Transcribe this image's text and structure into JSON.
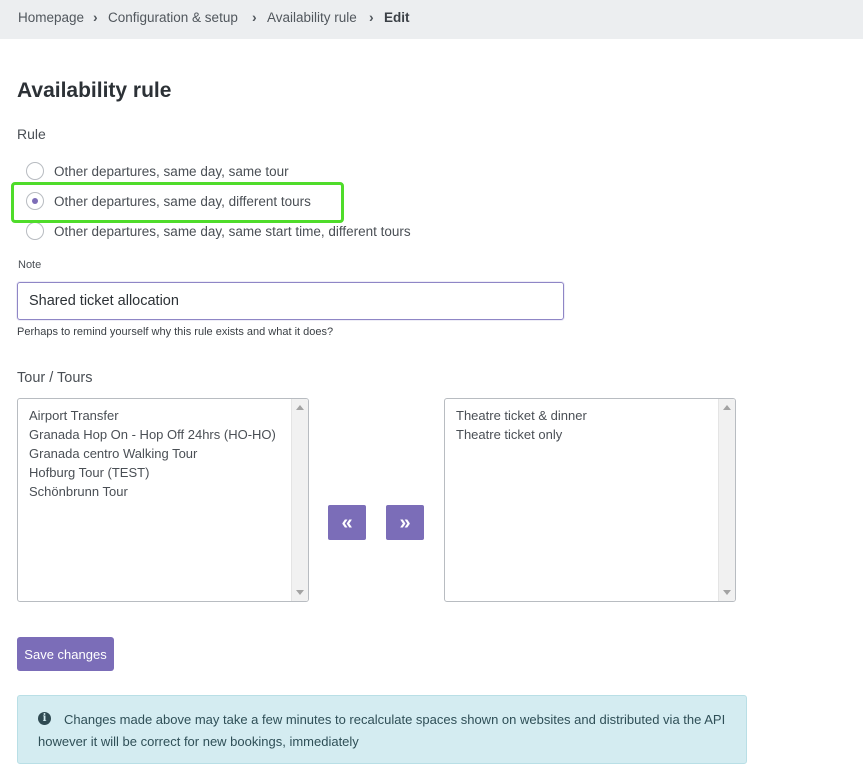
{
  "breadcrumb": {
    "items": [
      "Homepage",
      "Configuration & setup",
      "Availability rule"
    ],
    "current": "Edit",
    "separator": "›"
  },
  "page": {
    "title": "Availability rule"
  },
  "rule": {
    "label": "Rule",
    "options": [
      {
        "label": "Other departures, same day, same tour",
        "selected": false
      },
      {
        "label": "Other departures, same day, different tours",
        "selected": true
      },
      {
        "label": "Other departures, same day, same start time, different tours",
        "selected": false
      }
    ],
    "highlight_color": "#4fdc2a"
  },
  "note": {
    "label": "Note",
    "value": "Shared ticket allocation",
    "help": "Perhaps to remind yourself why this rule exists and what it does?"
  },
  "tours": {
    "label": "Tour / Tours",
    "available": [
      "Airport Transfer",
      "Granada Hop On - Hop Off 24hrs (HO-HO)",
      "Granada centro Walking Tour",
      "Hofburg Tour (TEST)",
      "Schönbrunn Tour"
    ],
    "selected": [
      "Theatre ticket & dinner",
      "Theatre ticket only"
    ],
    "move_left_icon": "«",
    "move_right_icon": "»"
  },
  "actions": {
    "save_label": "Save changes",
    "accent_color": "#7b6db8"
  },
  "info": {
    "icon": "i",
    "message": "Changes made above may take a few minutes to recalculate spaces shown on websites and distributed via the API however it will be correct for new bookings, immediately"
  }
}
